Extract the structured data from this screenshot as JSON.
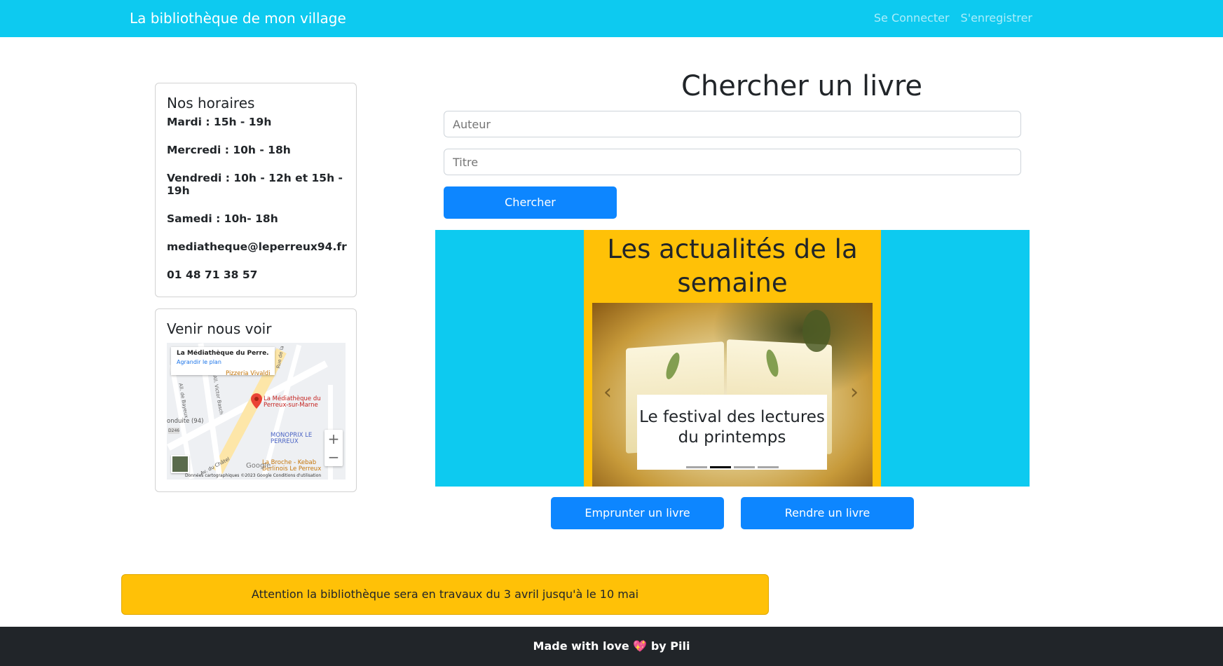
{
  "navbar": {
    "brand": "La bibliothèque de mon village",
    "login": "Se Connecter",
    "register": "S'enregistrer"
  },
  "hours": {
    "title": "Nos horaires",
    "lines": [
      "Mardi : 15h - 19h",
      "Mercredi : 10h - 18h",
      "Vendredi : 10h - 12h et 15h - 19h",
      "Samedi : 10h- 18h",
      "mediatheque@leperreux94.fr",
      "01 48 71 38 57"
    ]
  },
  "visit": {
    "title": "Venir nous voir",
    "map": {
      "info_title": "La Médiathèque du Perre...",
      "info_link": "Agrandir le plan",
      "labels": {
        "pizzeria": "Pizzeria Vivaldi",
        "mediatheque": "La Médiathèque du Perreux-sur-Marne",
        "monoprix": "MONOPRIX LE PERREUX",
        "broche": "La Broche - Kebab Berlinois Le Perreux",
        "conduite": "onduite (94)",
        "road_d246": "D246",
        "av_chatel": "Av. du Châtel",
        "all_bayeux": "All. de Bayeux",
        "all_victor": "All. Victor Basch",
        "rue_la": "Rue de la"
      },
      "zoom_in": "+",
      "zoom_out": "−",
      "google": "Google",
      "footer": "Données cartographiques ©2023 Google    Conditions d'utilisation"
    }
  },
  "search": {
    "title": "Chercher un livre",
    "author_placeholder": "Auteur",
    "title_placeholder": "Titre",
    "button": "Chercher"
  },
  "news": {
    "title": "Les actualités de la semaine",
    "slide_caption": "Le festival des lectures du printemps",
    "slide_count": 4,
    "active_slide": 1,
    "prev_icon": "‹",
    "next_icon": "›"
  },
  "actions": {
    "borrow": "Emprunter un livre",
    "return": "Rendre un livre"
  },
  "alert": {
    "text": "Attention la bibliothèque sera en travaux du 3 avril jusqu'à le 10 mai"
  },
  "footer": {
    "before": "Made with love ",
    "heart": "💖",
    "after": " by Pili"
  },
  "colors": {
    "navbar": "#0dcaf0",
    "primary": "#0d86ff",
    "warning": "#ffc107",
    "footer": "#212529"
  }
}
